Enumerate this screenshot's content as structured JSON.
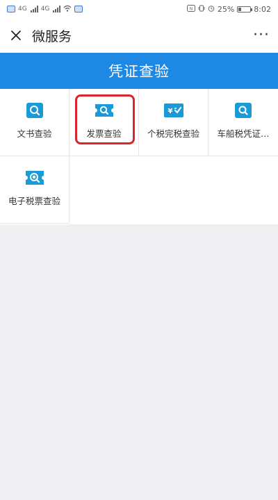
{
  "status_bar": {
    "network_1": "4G",
    "network_2": "4G",
    "battery_percent": "25%",
    "battery_level": 0.25,
    "time": "8:02"
  },
  "header": {
    "close_icon": "close-icon",
    "title": "微服务",
    "more_label": "···"
  },
  "section": {
    "title": "凭证查验"
  },
  "tiles": [
    {
      "label": "文书查验",
      "icon": "document-search-icon"
    },
    {
      "label": "发票查验",
      "icon": "invoice-search-icon"
    },
    {
      "label": "个税完税查验",
      "icon": "tax-check-icon"
    },
    {
      "label": "车船税凭证…",
      "icon": "vehicle-tax-search-icon"
    },
    {
      "label": "电子税票查验",
      "icon": "e-ticket-search-icon"
    }
  ],
  "colors": {
    "accent": "#1e88e5",
    "icon": "#1a9bd7",
    "highlight": "#d9252b"
  }
}
